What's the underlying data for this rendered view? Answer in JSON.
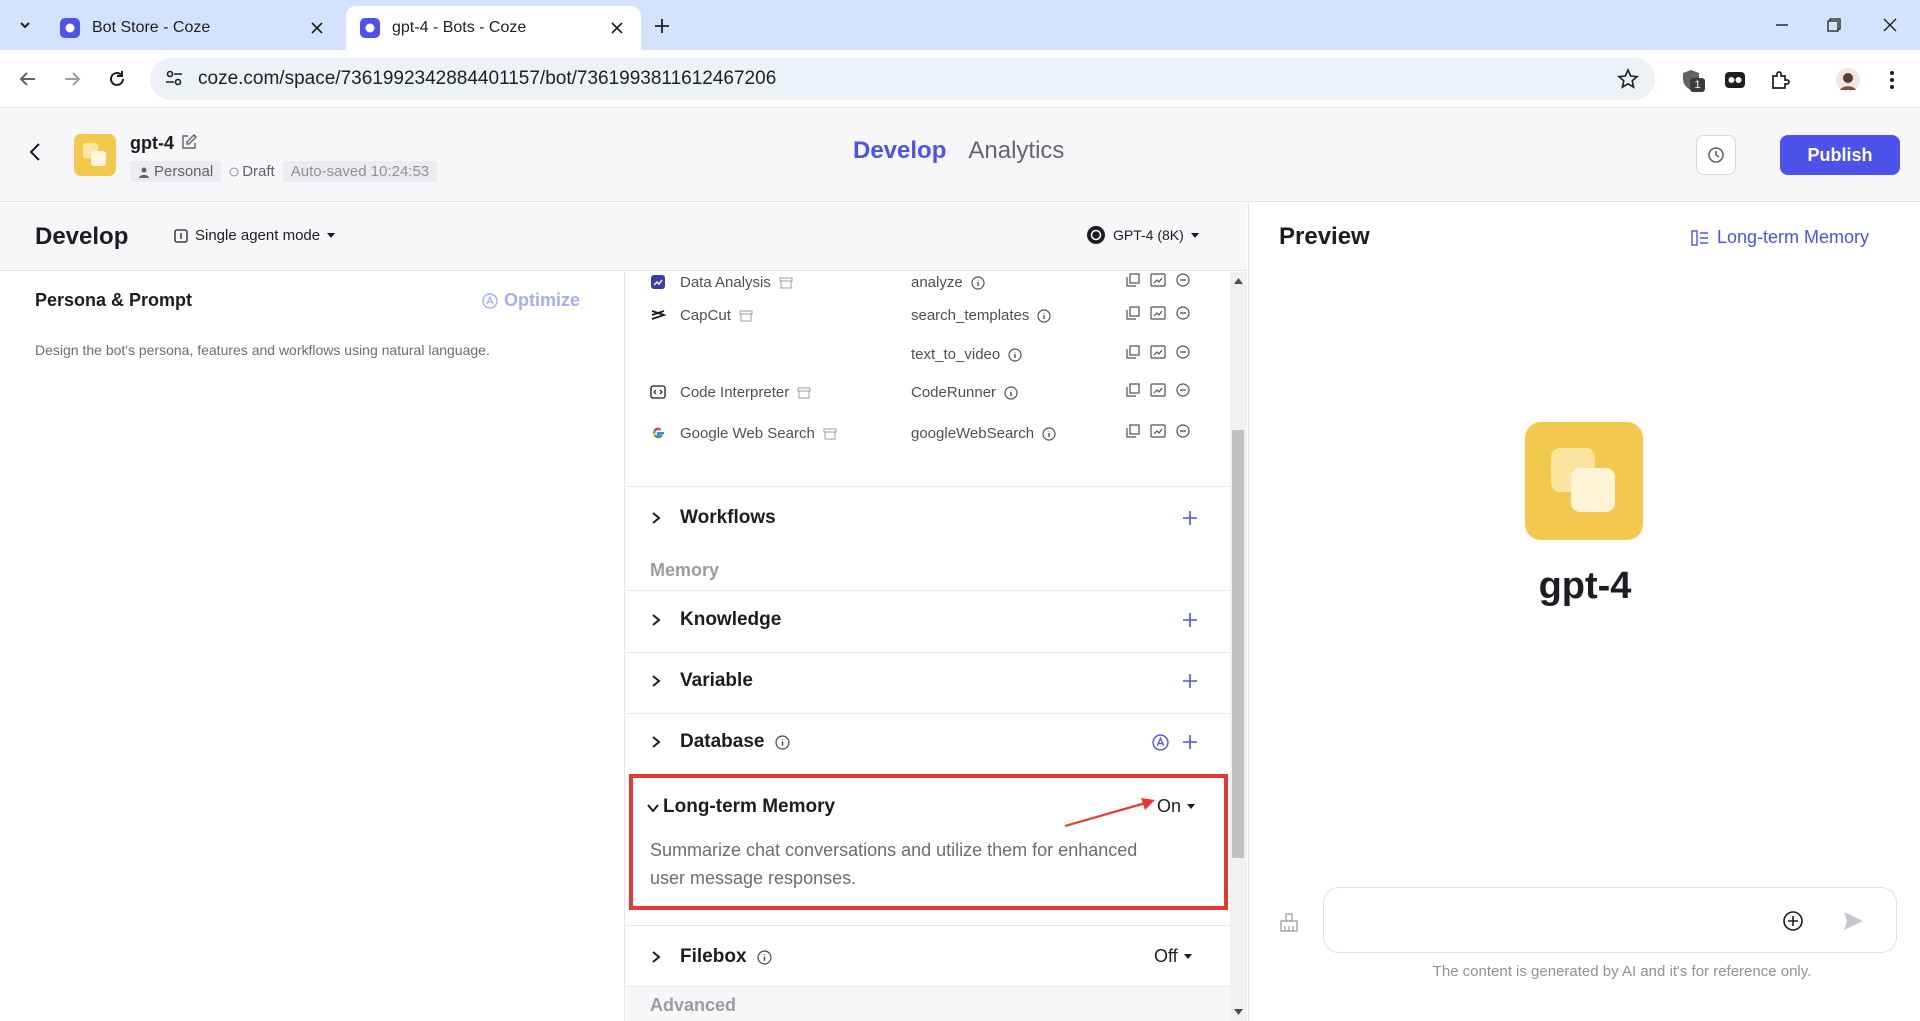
{
  "browser": {
    "tabs": [
      {
        "title": "Bot Store - Coze",
        "active": false
      },
      {
        "title": "gpt-4 - Bots - Coze",
        "active": true
      }
    ],
    "url": "coze.com/space/7361992342884401157/bot/7361993811612467206",
    "extension_badge": "1"
  },
  "header": {
    "bot_name": "gpt-4",
    "owner": "Personal",
    "status": "Draft",
    "autosave": "Auto-saved 10:24:53",
    "tabs": [
      "Develop",
      "Analytics"
    ],
    "active_tab": "Develop",
    "publish_label": "Publish"
  },
  "develop": {
    "title": "Develop",
    "mode": "Single agent mode",
    "model": "GPT-4 (8K)"
  },
  "persona": {
    "title": "Persona & Prompt",
    "optimize_label": "Optimize",
    "description": "Design the bot's persona, features and workflows using natural language."
  },
  "plugins": [
    {
      "name": "Data Analysis",
      "tool": "analyze",
      "icon": "data-analysis-icon"
    },
    {
      "name": "CapCut",
      "tool": "search_templates",
      "icon": "capcut-icon"
    },
    {
      "name": "",
      "tool": "text_to_video",
      "icon": ""
    },
    {
      "name": "Code Interpreter",
      "tool": "CodeRunner",
      "icon": "code-interpreter-icon"
    },
    {
      "name": "Google Web Search",
      "tool": "googleWebSearch",
      "icon": "google-icon"
    }
  ],
  "sections": {
    "workflows": "Workflows",
    "memory_group": "Memory",
    "knowledge": "Knowledge",
    "variable": "Variable",
    "database": "Database",
    "long_term_memory": {
      "label": "Long-term Memory",
      "state": "On",
      "description": "Summarize chat conversations and utilize them for enhanced user message responses."
    },
    "filebox": {
      "label": "Filebox",
      "state": "Off"
    },
    "advanced_group": "Advanced"
  },
  "preview": {
    "title": "Preview",
    "memory_link": "Long-term Memory",
    "bot_name": "gpt-4",
    "input_placeholder": "",
    "disclaimer": "The content is generated by AI and it's for reference only."
  },
  "colors": {
    "accent": "#4d53e8",
    "highlight_box": "#e53935",
    "bot_icon": "#f2c94c"
  }
}
